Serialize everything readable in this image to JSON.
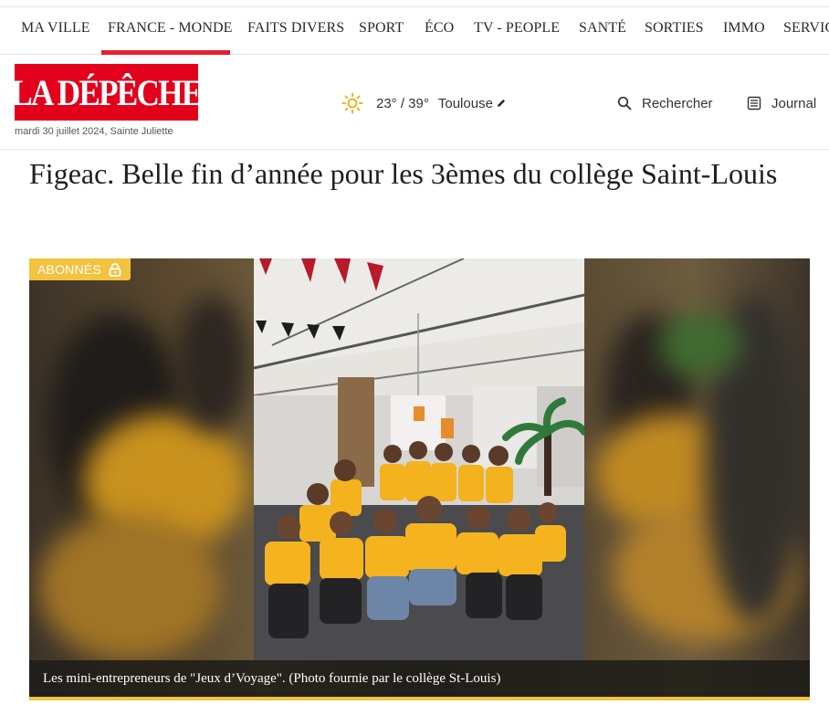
{
  "nav": {
    "items": [
      {
        "label": "MA VILLE"
      },
      {
        "label": "FRANCE - MONDE"
      },
      {
        "label": "FAITS DIVERS"
      },
      {
        "label": "SPORT"
      },
      {
        "label": "ÉCO"
      },
      {
        "label": "TV - PEOPLE"
      },
      {
        "label": "SANTÉ"
      },
      {
        "label": "SORTIES"
      },
      {
        "label": "IMMO"
      },
      {
        "label": "SERVICES"
      }
    ],
    "active": "FRANCE - MONDE"
  },
  "header": {
    "logo_text": "LA DÉPÊCHE",
    "date": "mardi 30 juillet 2024, Sainte Juliette",
    "weather": {
      "icon": "sun-icon",
      "temperature": "23° / 39°",
      "city": "Toulouse"
    },
    "search_label": "Rechercher",
    "journal_label": "Journal"
  },
  "article": {
    "title": "Figeac. Belle fin d’année pour les 3èmes du collège Saint-Louis",
    "badge": "ABONNÉS",
    "caption": "Les mini-entrepreneurs de \"Jeux d’Voyage\". (Photo fournie par le collège St-Louis)"
  },
  "colors": {
    "brand_red": "#e3001b",
    "nav_active": "#e6202e",
    "subscriber_yellow": "#f3c23e"
  }
}
